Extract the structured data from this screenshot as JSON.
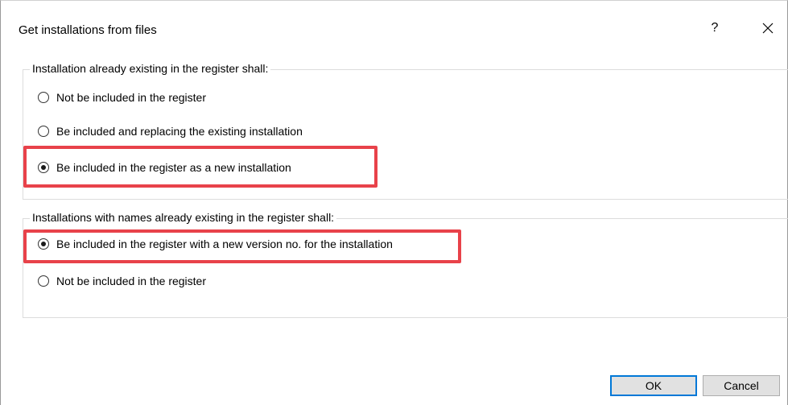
{
  "dialog": {
    "title": "Get installations from files",
    "help_label": "?",
    "close_icon": "close-icon"
  },
  "group_existing": {
    "legend": "Installation already existing in the register shall:",
    "options": [
      {
        "label": "Not be included in the register",
        "selected": false
      },
      {
        "label": "Be included and replacing the existing installation",
        "selected": false
      },
      {
        "label": "Be included in the register as a new installation",
        "selected": true
      }
    ]
  },
  "group_names": {
    "legend": "Installations with names already existing in the register shall:",
    "options": [
      {
        "label": "Be included in the register with a new version no. for the installation",
        "selected": true
      },
      {
        "label": "Not be included in the register",
        "selected": false
      }
    ]
  },
  "buttons": {
    "ok_label": "OK",
    "cancel_label": "Cancel"
  },
  "colors": {
    "highlight": "#e8424a",
    "default_button_border": "#0078d7"
  }
}
